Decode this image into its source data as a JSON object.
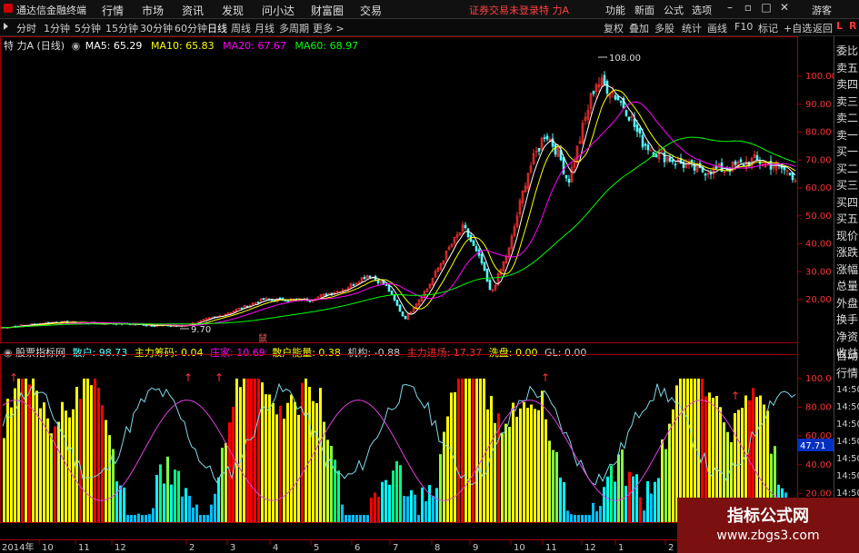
{
  "titlebar": {
    "app_name": "通达信金融终端",
    "menus": [
      "行情",
      "市场",
      "资讯",
      "发现",
      "问小达",
      "财富圈",
      "交易"
    ],
    "status_message": "证券交易未登录",
    "stock_name": "特 力A",
    "right_menus": [
      "功能",
      "新面",
      "公式",
      "选项"
    ],
    "guest": "游客"
  },
  "toolbar": {
    "periods": [
      "分时",
      "1分钟",
      "5分钟",
      "15分钟",
      "30分钟",
      "60分钟",
      "日线",
      "周线",
      "月线",
      "多周期",
      "更多 >"
    ],
    "active_period": "日线",
    "buttons": [
      "复权",
      "叠加",
      "多股",
      "统计",
      "画线",
      "F10",
      "标记",
      "+自选",
      "返回"
    ]
  },
  "ma_line": {
    "title": "特 力A (日线)",
    "ma5": "MA5: 65.29",
    "ma10": "MA10: 65.83",
    "ma20": "MA20: 67.67",
    "ma60": "MA60: 68.97"
  },
  "indicator_line": {
    "name": "股票指标网",
    "sanhu": "散户: 98.73",
    "zhuli": "主力筹码: 0.04",
    "zhuangjia": "庄家: 10.69",
    "sanhu_energy": "散户能量: 0.38",
    "jigou": "机构: -0.88",
    "zhuli_jinchang": "主力进场: 17.37",
    "xipan": "洗盘: 0.00",
    "gl": "GL: 0.00"
  },
  "price_axis": [
    "100.00",
    "90.00",
    "80.00",
    "70.00",
    "60.00",
    "50.00",
    "40.00",
    "30.00",
    "20.00"
  ],
  "indicator_axis": [
    "100.0",
    "80.00",
    "60.00",
    "40.00",
    "20.00"
  ],
  "indicator_current": "47.71",
  "annotations": {
    "high": "108.00",
    "low": "9.70",
    "marker": "鼠"
  },
  "time_axis": {
    "year": "2014年",
    "months": [
      "10",
      "11",
      "12",
      "2",
      "3",
      "4",
      "5",
      "6",
      "7",
      "8",
      "9",
      "10",
      "11",
      "12",
      "1",
      "2"
    ]
  },
  "right_panel": {
    "top": [
      "L",
      "R"
    ],
    "items": [
      "委比",
      "卖五",
      "卖四",
      "卖三",
      "卖二",
      "卖一",
      "买一",
      "买二",
      "买三",
      "买四",
      "买五",
      "现价",
      "涨跌",
      "涨幅",
      "总量",
      "外盘",
      "换手",
      "净资",
      "收益"
    ],
    "bottom": [
      "自动",
      "行情",
      "14:50",
      "14:50",
      "14:50",
      "14:50",
      "14:50",
      "14:50",
      "14:50",
      "14:50",
      "14:50"
    ]
  },
  "watermark": {
    "title": "指标公式网",
    "url": "www.zbgs3.com"
  },
  "colors": {
    "ma5": "#ffffff",
    "ma10": "#ffff00",
    "ma20": "#ff00ff",
    "ma60": "#00ff00",
    "up": "#ff3232",
    "down": "#54ffff",
    "panel_border": "#a00000"
  }
}
